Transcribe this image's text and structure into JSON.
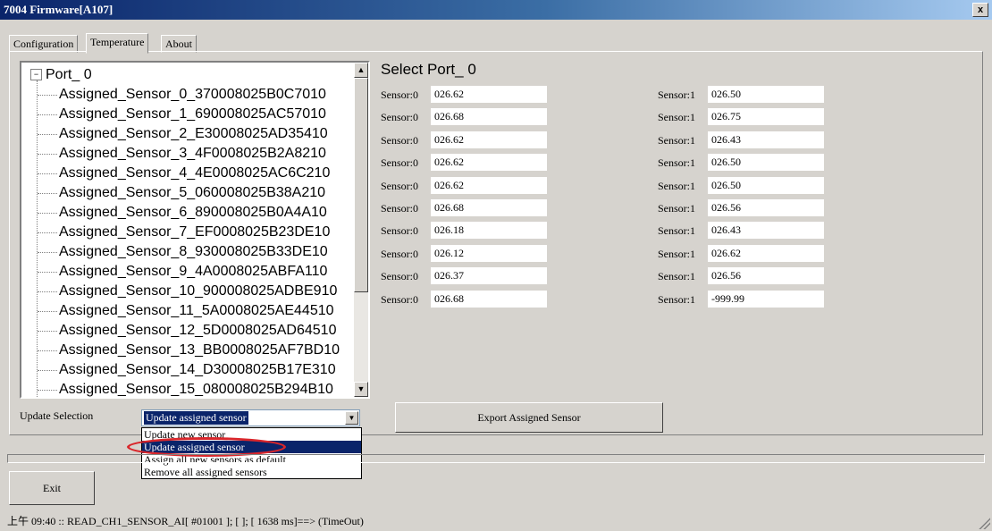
{
  "window": {
    "title": "7004 Firmware[A107]",
    "close_glyph": "x"
  },
  "tabs": [
    {
      "label": "Configuration",
      "active": false
    },
    {
      "label": "Temperature",
      "active": true
    },
    {
      "label": "About",
      "active": false
    }
  ],
  "tree": {
    "port_label": "Port_ 0",
    "expander": "⊟",
    "items": [
      "Assigned_Sensor_0_370008025B0C7010",
      "Assigned_Sensor_1_690008025AC57010",
      "Assigned_Sensor_2_E30008025AD35410",
      "Assigned_Sensor_3_4F0008025B2A8210",
      "Assigned_Sensor_4_4E0008025AC6C210",
      "Assigned_Sensor_5_060008025B38A210",
      "Assigned_Sensor_6_890008025B0A4A10",
      "Assigned_Sensor_7_EF0008025B23DE10",
      "Assigned_Sensor_8_930008025B33DE10",
      "Assigned_Sensor_9_4A0008025ABFA110",
      "Assigned_Sensor_10_900008025ADBE910",
      "Assigned_Sensor_11_5A0008025AE44510",
      "Assigned_Sensor_12_5D0008025AD64510",
      "Assigned_Sensor_13_BB0008025AF7BD10",
      "Assigned_Sensor_14_D30008025B17E310",
      "Assigned_Sensor_15_080008025B294B10"
    ]
  },
  "select_title": "Select Port_ 0",
  "sensors": {
    "left_label": "Sensor:0",
    "right_label": "Sensor:1",
    "left_values": [
      "026.62",
      "026.68",
      "026.62",
      "026.62",
      "026.62",
      "026.68",
      "026.18",
      "026.12",
      "026.37",
      "026.68"
    ],
    "right_values": [
      "026.50",
      "026.75",
      "026.43",
      "026.50",
      "026.50",
      "026.56",
      "026.43",
      "026.62",
      "026.56",
      "-999.99"
    ]
  },
  "update_selection": {
    "label": "Update Selection",
    "selected": "Update assigned sensor",
    "options": [
      "Update new sensor",
      "Update assigned sensor",
      "Assign all new sensors as default",
      "Remove all assigned sensors"
    ],
    "selected_index": 1
  },
  "buttons": {
    "export": "Export Assigned Sensor",
    "exit": "Exit"
  },
  "status": "上午 09:40 :: READ_CH1_SENSOR_AI[ #01001 ]; [ ]; [ 1638 ms]==> (TimeOut)",
  "colors": {
    "highlight": "#d9262b",
    "selection": "#0a246a"
  }
}
